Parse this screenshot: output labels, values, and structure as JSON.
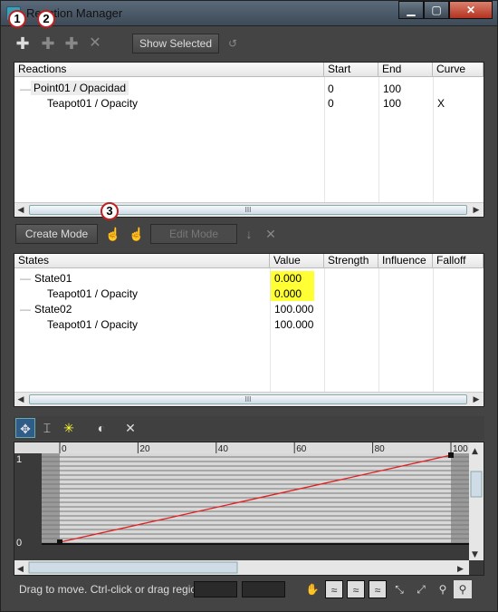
{
  "window": {
    "title": "Reaction Manager",
    "min": "▁",
    "max": "▢",
    "close": "✕"
  },
  "callouts": [
    "1",
    "2",
    "3"
  ],
  "toolbar": {
    "show_selected": "Show Selected"
  },
  "reactions": {
    "headers": [
      "Reactions",
      "Start",
      "End",
      "Curve"
    ],
    "rows": [
      {
        "name": "Point01 / Opacidad",
        "start": "0",
        "end": "100",
        "curve": "",
        "expander": "—"
      },
      {
        "name": "Teapot01 / Opacity",
        "start": "0",
        "end": "100",
        "curve": "X",
        "expander": ""
      }
    ]
  },
  "modes": {
    "create": "Create Mode",
    "edit": "Edit Mode"
  },
  "states": {
    "headers": [
      "States",
      "Value",
      "Strength",
      "Influence",
      "Falloff"
    ],
    "rows": [
      {
        "name": "State01",
        "value": "0.000",
        "expander": "—"
      },
      {
        "name": "Teapot01 / Opacity",
        "value": "0.000",
        "expander": ""
      },
      {
        "name": "State02",
        "value": "100.000",
        "expander": "—"
      },
      {
        "name": "Teapot01 / Opacity",
        "value": "100.000",
        "expander": ""
      }
    ]
  },
  "scroll": {
    "thumb_grip": "III",
    "left": "◀",
    "right": "▶"
  },
  "curve": {
    "x_ticks": [
      "0",
      "20",
      "40",
      "60",
      "80",
      "100"
    ],
    "y_labels": [
      "1",
      "0"
    ],
    "line_color": "#e02020",
    "scroll_up": "▲",
    "scroll_down": "▼"
  },
  "status": {
    "message": "Drag to move. Ctrl-click or drag region b"
  }
}
